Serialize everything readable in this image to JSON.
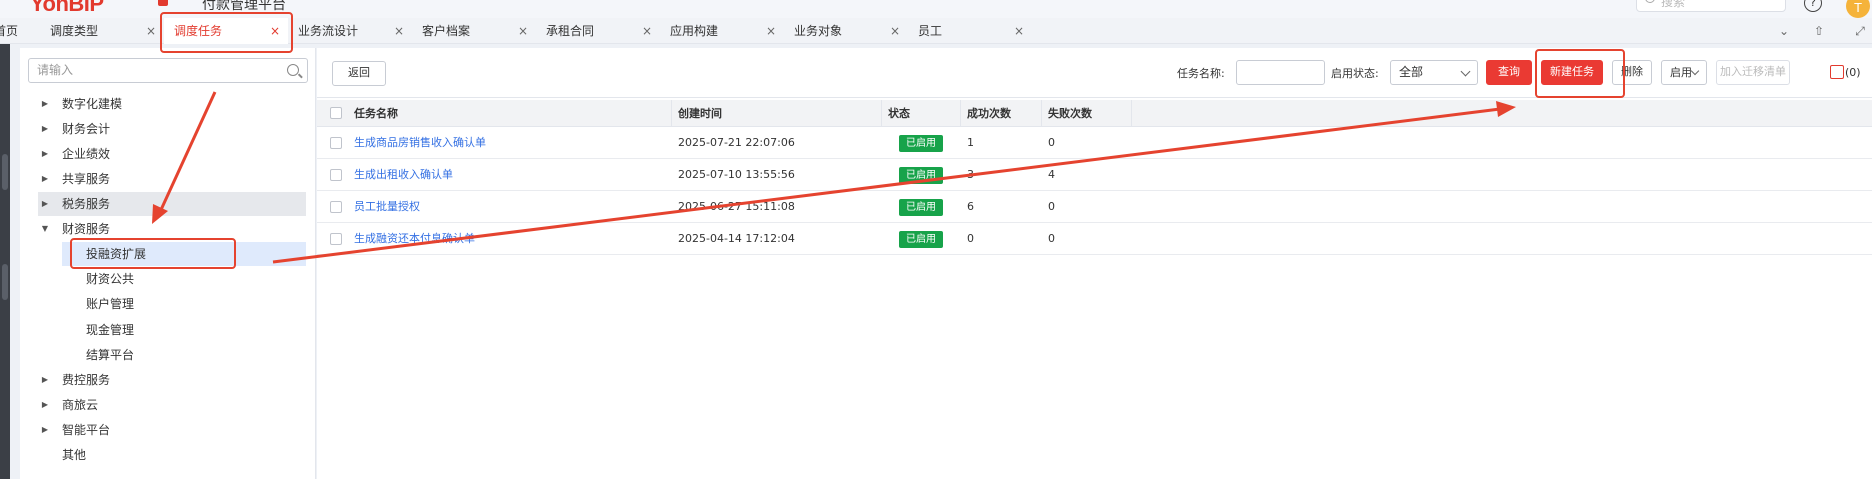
{
  "header": {
    "logo": "YonBIP",
    "platform_name": "付款管理平台",
    "search_placeholder": "搜索",
    "help": "?",
    "avatar_text": "T"
  },
  "tabs": [
    {
      "label": "首页",
      "active": false,
      "closable": false
    },
    {
      "label": "调度类型",
      "active": false,
      "closable": true
    },
    {
      "label": "调度任务",
      "active": true,
      "closable": true
    },
    {
      "label": "业务流设计",
      "active": false,
      "closable": true
    },
    {
      "label": "客户档案",
      "active": false,
      "closable": true
    },
    {
      "label": "承租合同",
      "active": false,
      "closable": true
    },
    {
      "label": "应用构建",
      "active": false,
      "closable": true
    },
    {
      "label": "业务对象",
      "active": false,
      "closable": true
    },
    {
      "label": "员工",
      "active": false,
      "closable": true
    }
  ],
  "tree": {
    "search_placeholder": "请输入",
    "items": [
      {
        "label": "数字化建模",
        "level": 1,
        "arrow": "collapsed"
      },
      {
        "label": "财务会计",
        "level": 1,
        "arrow": "collapsed"
      },
      {
        "label": "企业绩效",
        "level": 1,
        "arrow": "collapsed"
      },
      {
        "label": "共享服务",
        "level": 1,
        "arrow": "collapsed"
      },
      {
        "label": "税务服务",
        "level": 1,
        "arrow": "collapsed",
        "state": "hover"
      },
      {
        "label": "财资服务",
        "level": 1,
        "arrow": "expanded"
      },
      {
        "label": "投融资扩展",
        "level": 2,
        "state": "selected"
      },
      {
        "label": "财资公共",
        "level": 2
      },
      {
        "label": "账户管理",
        "level": 2
      },
      {
        "label": "现金管理",
        "level": 2
      },
      {
        "label": "结算平台",
        "level": 2
      },
      {
        "label": "费控服务",
        "level": 1,
        "arrow": "collapsed"
      },
      {
        "label": "商旅云",
        "level": 1,
        "arrow": "collapsed"
      },
      {
        "label": "智能平台",
        "level": 1,
        "arrow": "collapsed"
      },
      {
        "label": "其他",
        "level": 1
      }
    ]
  },
  "toolbar": {
    "back_label": "返回",
    "task_name_label": "任务名称:",
    "task_name_value": "",
    "enable_status_label": "启用状态:",
    "enable_status_value": "全部",
    "query_label": "查询",
    "new_task_label": "新建任务",
    "delete_label": "删除",
    "enable_label": "启用",
    "add_migration_label": "加入迁移清单",
    "export_count": "(0)"
  },
  "table": {
    "columns": [
      "任务名称",
      "创建时间",
      "状态",
      "成功次数",
      "失败次数"
    ],
    "rows": [
      {
        "name": "生成商品房销售收入确认单",
        "created": "2025-07-21 22:07:06",
        "status": "已启用",
        "success": "1",
        "fail": "0"
      },
      {
        "name": "生成出租收入确认单",
        "created": "2025-07-10 13:55:56",
        "status": "已启用",
        "success": "3",
        "fail": "4"
      },
      {
        "name": "员工批量授权",
        "created": "2025-06-27 15:11:08",
        "status": "已启用",
        "success": "6",
        "fail": "0"
      },
      {
        "name": "生成融资还本付息确认单",
        "created": "2025-04-14 17:12:04",
        "status": "已启用",
        "success": "0",
        "fail": "0"
      }
    ]
  },
  "colors": {
    "accent": "#e23a2e",
    "primary_button": "#ea3a33",
    "link": "#3470e3",
    "status_enabled": "#17a34a",
    "annotation": "#e5432f"
  }
}
